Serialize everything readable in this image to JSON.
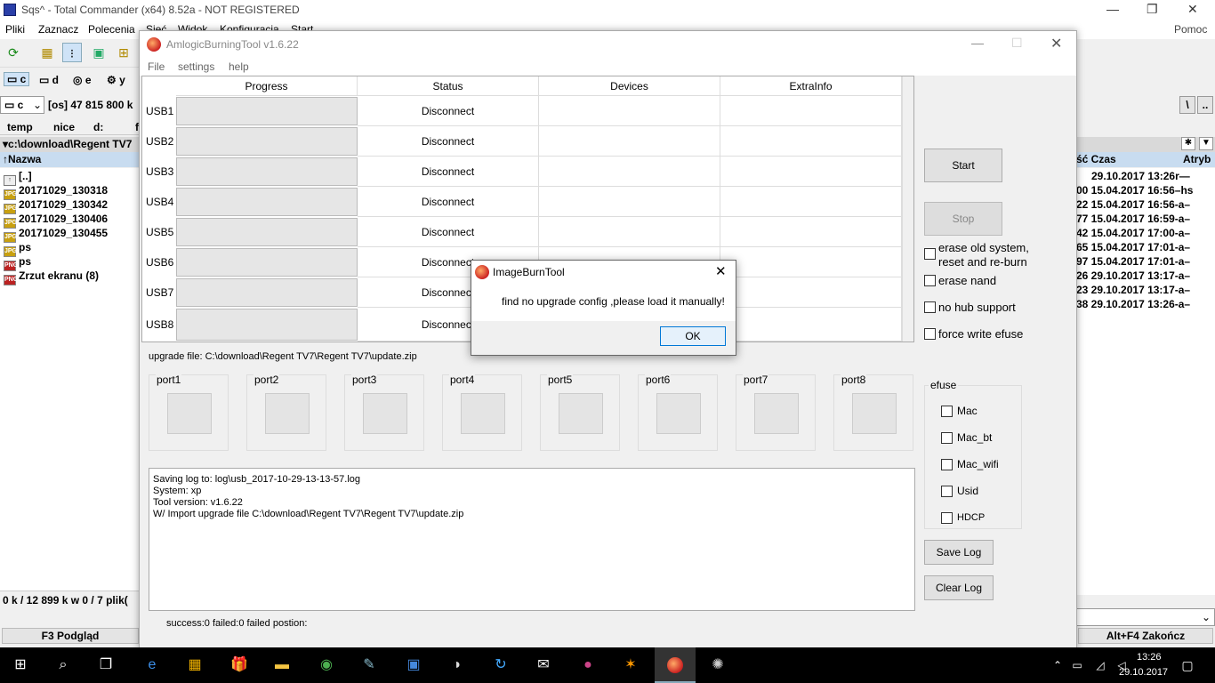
{
  "tc": {
    "title": "Sqs^ - Total Commander (x64) 8.52a - NOT REGISTERED",
    "menu": [
      "Pliki",
      "Zaznacz",
      "Polecenia",
      "Sieć",
      "Widok",
      "Konfiguracja",
      "Start"
    ],
    "help": "Pomoc",
    "drives": [
      "c",
      "d",
      "e",
      "y"
    ],
    "drive_select": "c",
    "drive_info": "[os]  47 815 800 k",
    "tabs": [
      "temp",
      "nice",
      "d:",
      "f"
    ],
    "path": "▾c:\\download\\Regent TV7",
    "col_name": "↑Nazwa",
    "files": [
      {
        "name": "[..]",
        "icon": "up"
      },
      {
        "name": "20171029_130318",
        "icon": "jpg"
      },
      {
        "name": "20171029_130342",
        "icon": "jpg"
      },
      {
        "name": "20171029_130406",
        "icon": "jpg"
      },
      {
        "name": "20171029_130455",
        "icon": "jpg"
      },
      {
        "name": "ps",
        "icon": "jpg"
      },
      {
        "name": "ps",
        "icon": "png"
      },
      {
        "name": "Zrzut ekranu (8)",
        "icon": "png"
      }
    ],
    "status_left": "0 k / 12 899 k w 0 / 7 plik(",
    "f3": "F3 Podgląd",
    "altf4": "Alt+F4 Zakończ",
    "right_header": {
      "czas": "ść Czas",
      "atryb": "Atryb"
    },
    "right_rows": [
      "29.10.2017 13:26r—",
      "00  15.04.2017 16:56–hs",
      "22  15.04.2017 16:56-a–",
      "77  15.04.2017 16:59-a–",
      "42  15.04.2017 17:00-a–",
      "65  15.04.2017 17:01-a–",
      "97  15.04.2017 17:01-a–",
      "26  29.10.2017 13:17-a–",
      "23  29.10.2017 13:17-a–",
      "38  29.10.2017 13:26-a–"
    ],
    "sep_btns": [
      "\\",
      ".."
    ]
  },
  "app": {
    "title": "AmlogicBurningTool  v1.6.22",
    "menu": [
      "File",
      "settings",
      "help"
    ],
    "columns": [
      "Progress",
      "Status",
      "Devices",
      "ExtraInfo"
    ],
    "rows": [
      {
        "usb": "USB1",
        "status": "Disconnect"
      },
      {
        "usb": "USB2",
        "status": "Disconnect"
      },
      {
        "usb": "USB3",
        "status": "Disconnect"
      },
      {
        "usb": "USB4",
        "status": "Disconnect"
      },
      {
        "usb": "USB5",
        "status": "Disconnect"
      },
      {
        "usb": "USB6",
        "status": "Disconnect"
      },
      {
        "usb": "USB7",
        "status": "Disconnect"
      },
      {
        "usb": "USB8",
        "status": "Disconnect"
      }
    ],
    "start": "Start",
    "stop": "Stop",
    "options": {
      "erase_old_1": "erase old system,",
      "erase_old_2": "reset and re-burn",
      "erase_nand": "erase nand",
      "no_hub": "no hub support",
      "force_efuse": "force write efuse"
    },
    "upgrade_file": "upgrade file: C:\\download\\Regent TV7\\Regent TV7\\update.zip",
    "ports": [
      "port1",
      "port2",
      "port3",
      "port4",
      "port5",
      "port6",
      "port7",
      "port8"
    ],
    "efuse": {
      "label": "efuse",
      "items": [
        "Mac",
        "Mac_bt",
        "Mac_wifi",
        "Usid",
        "HDCP"
      ]
    },
    "log_lines": [
      "Saving log to: log\\usb_2017-10-29-13-13-57.log",
      "System: xp",
      "Tool version: v1.6.22",
      "W/ Import upgrade file C:\\download\\Regent TV7\\Regent TV7\\update.zip"
    ],
    "save_log": "Save Log",
    "clear_log": "Clear Log",
    "footer": "success:0 failed:0 failed postion:"
  },
  "dialog": {
    "title": "ImageBurnTool",
    "message": "find no upgrade config ,please load it manually!",
    "ok": "OK"
  },
  "clock": {
    "time": "13:26",
    "date": "29.10.2017"
  }
}
